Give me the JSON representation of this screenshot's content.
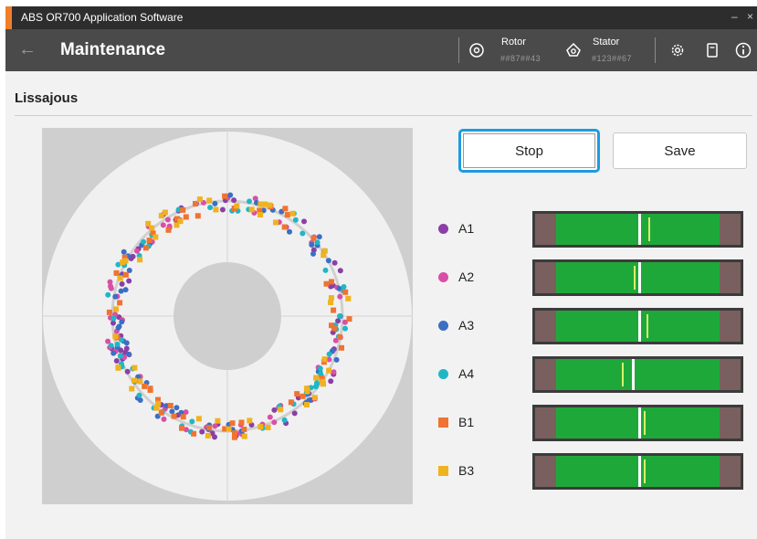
{
  "window": {
    "title": "ABS OR700 Application Software",
    "minimize": "–",
    "close": "×"
  },
  "header": {
    "title": "Maintenance",
    "rotor": {
      "label": "Rotor",
      "value": "##87##43"
    },
    "stator": {
      "label": "Stator",
      "value": "#123##67"
    }
  },
  "section": {
    "title": "Lissajous"
  },
  "buttons": {
    "stop": "Stop",
    "save": "Save"
  },
  "channels": [
    {
      "name": "A1",
      "color": "#8b3fa6",
      "shape": "dot",
      "fill": 0.5,
      "tick": 0.55
    },
    {
      "name": "A2",
      "color": "#d94fa8",
      "shape": "dot",
      "fill": 0.5,
      "tick": 0.48
    },
    {
      "name": "A3",
      "color": "#3a6fc4",
      "shape": "dot",
      "fill": 0.5,
      "tick": 0.54
    },
    {
      "name": "A4",
      "color": "#1fb7c6",
      "shape": "dot",
      "fill": 0.47,
      "tick": 0.42
    },
    {
      "name": "B1",
      "color": "#f07331",
      "shape": "square",
      "fill": 0.5,
      "tick": 0.53
    },
    {
      "name": "B3",
      "color": "#f0b21f",
      "shape": "square",
      "fill": 0.5,
      "tick": 0.53
    }
  ]
}
